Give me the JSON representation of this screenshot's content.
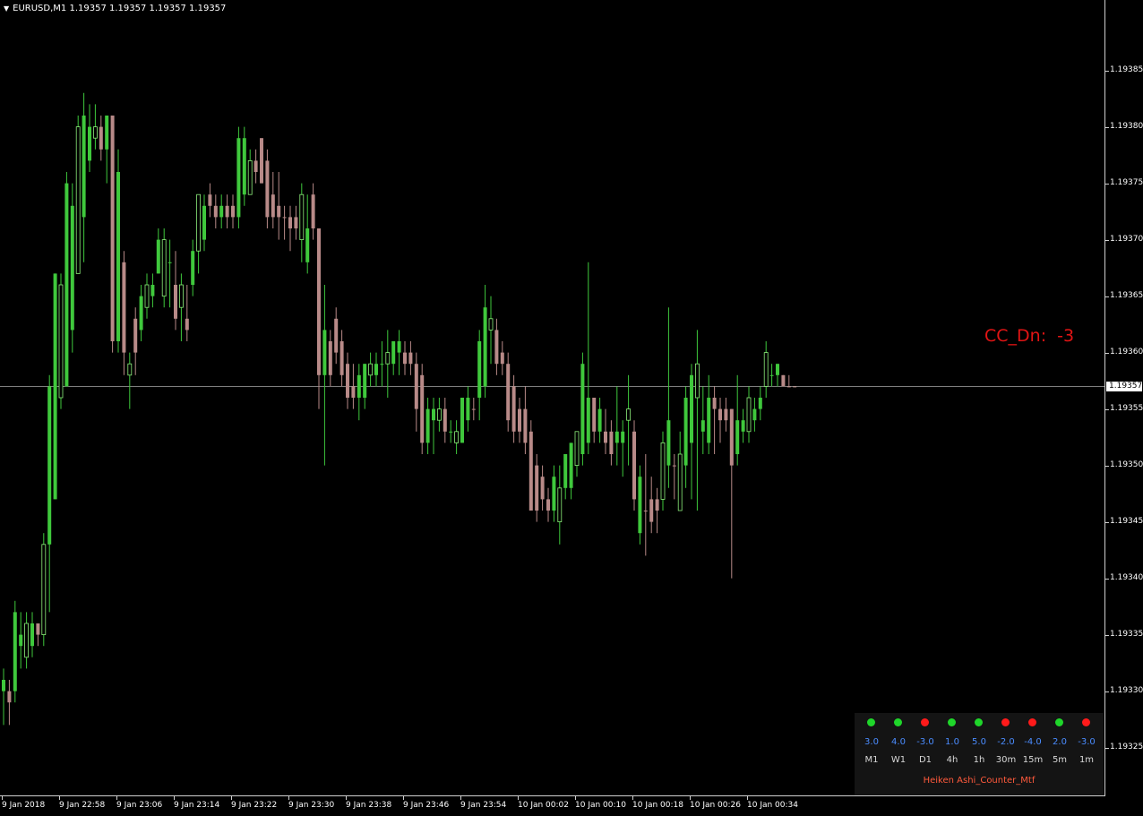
{
  "title": {
    "symbol_line": "EURUSD,M1  1.19357 1.19357 1.19357 1.19357"
  },
  "colors": {
    "background": "#000000",
    "bull": "#3fc83c",
    "bull_outline": "#8ef07c",
    "bear": "#b88a88",
    "wick": "#3fc83c",
    "cc_label": "#e11414",
    "mtf_value": "#4a8cff",
    "dot_up": "#1fd62a",
    "dot_down": "#ff1a1a",
    "indicator_name": "#ff5a3c"
  },
  "price_axis": {
    "labels": [
      "1.19385",
      "1.19380",
      "1.19375",
      "1.19370",
      "1.19365",
      "1.19360",
      "1.19355",
      "1.19350",
      "1.19345",
      "1.19340",
      "1.19335",
      "1.19330",
      "1.19325"
    ],
    "current_price": "1.19357"
  },
  "time_axis": {
    "labels": [
      "9 Jan 2018",
      "9 Jan 22:58",
      "9 Jan 23:06",
      "9 Jan 23:14",
      "9 Jan 23:22",
      "9 Jan 23:30",
      "9 Jan 23:38",
      "9 Jan 23:46",
      "9 Jan 23:54",
      "10 Jan 00:02",
      "10 Jan 00:10",
      "10 Jan 00:18",
      "10 Jan 00:26",
      "10 Jan 00:34"
    ]
  },
  "cc_label": {
    "text": "CC_Dn:  -3"
  },
  "mtf_panel": {
    "indicator_name": "Heiken Ashi_Counter_Mtf",
    "timeframes": [
      {
        "tf": "M1",
        "value": "3.0",
        "dir": "up"
      },
      {
        "tf": "W1",
        "value": "4.0",
        "dir": "up"
      },
      {
        "tf": "D1",
        "value": "-3.0",
        "dir": "down"
      },
      {
        "tf": "4h",
        "value": "1.0",
        "dir": "up"
      },
      {
        "tf": "1h",
        "value": "5.0",
        "dir": "up"
      },
      {
        "tf": "30m",
        "value": "-2.0",
        "dir": "down"
      },
      {
        "tf": "15m",
        "value": "-4.0",
        "dir": "down"
      },
      {
        "tf": "5m",
        "value": "2.0",
        "dir": "up"
      },
      {
        "tf": "1m",
        "value": "-3.0",
        "dir": "down"
      }
    ]
  },
  "chart_data": {
    "type": "candlestick",
    "symbol": "EURUSD",
    "timeframe": "M1",
    "ylim": [
      1.19321,
      1.19391
    ],
    "current_price": 1.19357,
    "candles": [
      {
        "o": 1.1933,
        "h": 1.19332,
        "l": 1.19327,
        "c": 1.19331,
        "s": "bull"
      },
      {
        "o": 1.19329,
        "h": 1.19331,
        "l": 1.19327,
        "c": 1.1933,
        "s": "bear"
      },
      {
        "o": 1.1933,
        "h": 1.19338,
        "l": 1.19329,
        "c": 1.19337,
        "s": "bull"
      },
      {
        "o": 1.19334,
        "h": 1.19337,
        "l": 1.19332,
        "c": 1.19335,
        "s": "bull"
      },
      {
        "o": 1.19333,
        "h": 1.19337,
        "l": 1.19332,
        "c": 1.19336,
        "s": "bull"
      },
      {
        "o": 1.19334,
        "h": 1.19337,
        "l": 1.19333,
        "c": 1.19336,
        "s": "bull"
      },
      {
        "o": 1.19336,
        "h": 1.19336,
        "l": 1.19334,
        "c": 1.19335,
        "s": "bear"
      },
      {
        "o": 1.19335,
        "h": 1.19344,
        "l": 1.19334,
        "c": 1.19343,
        "s": "bull"
      },
      {
        "o": 1.19343,
        "h": 1.19358,
        "l": 1.19337,
        "c": 1.19357,
        "s": "bull"
      },
      {
        "o": 1.19347,
        "h": 1.19367,
        "l": 1.19347,
        "c": 1.19367,
        "s": "bull"
      },
      {
        "o": 1.19356,
        "h": 1.19367,
        "l": 1.19355,
        "c": 1.19366,
        "s": "bull"
      },
      {
        "o": 1.19357,
        "h": 1.19376,
        "l": 1.19357,
        "c": 1.19375,
        "s": "bull"
      },
      {
        "o": 1.19362,
        "h": 1.19375,
        "l": 1.1936,
        "c": 1.19373,
        "s": "bull"
      },
      {
        "o": 1.19367,
        "h": 1.19381,
        "l": 1.19367,
        "c": 1.1938,
        "s": "bull"
      },
      {
        "o": 1.19372,
        "h": 1.19383,
        "l": 1.19368,
        "c": 1.19381,
        "s": "bull"
      },
      {
        "o": 1.19377,
        "h": 1.19382,
        "l": 1.19376,
        "c": 1.1938,
        "s": "bull"
      },
      {
        "o": 1.19379,
        "h": 1.19382,
        "l": 1.19378,
        "c": 1.1938,
        "s": "bull"
      },
      {
        "o": 1.1938,
        "h": 1.19381,
        "l": 1.19377,
        "c": 1.19378,
        "s": "bear"
      },
      {
        "o": 1.19378,
        "h": 1.19381,
        "l": 1.19375,
        "c": 1.19381,
        "s": "bull"
      },
      {
        "o": 1.19381,
        "h": 1.19381,
        "l": 1.1936,
        "c": 1.19361,
        "s": "bear"
      },
      {
        "o": 1.19376,
        "h": 1.19378,
        "l": 1.1936,
        "c": 1.19361,
        "s": "bull"
      },
      {
        "o": 1.19368,
        "h": 1.19369,
        "l": 1.19358,
        "c": 1.1936,
        "s": "bear"
      },
      {
        "o": 1.19358,
        "h": 1.1936,
        "l": 1.19355,
        "c": 1.19359,
        "s": "bull"
      },
      {
        "o": 1.19363,
        "h": 1.19364,
        "l": 1.19358,
        "c": 1.1936,
        "s": "bear"
      },
      {
        "o": 1.19362,
        "h": 1.19366,
        "l": 1.19361,
        "c": 1.19365,
        "s": "bull"
      },
      {
        "o": 1.19364,
        "h": 1.19367,
        "l": 1.19363,
        "c": 1.19366,
        "s": "bull"
      },
      {
        "o": 1.19365,
        "h": 1.19367,
        "l": 1.19364,
        "c": 1.19366,
        "s": "bull"
      },
      {
        "o": 1.19367,
        "h": 1.19371,
        "l": 1.19367,
        "c": 1.1937,
        "s": "bull"
      },
      {
        "o": 1.19365,
        "h": 1.19371,
        "l": 1.19364,
        "c": 1.1937,
        "s": "bull"
      },
      {
        "o": 1.19368,
        "h": 1.1937,
        "l": 1.19364,
        "c": 1.19368,
        "s": "bull"
      },
      {
        "o": 1.19366,
        "h": 1.19369,
        "l": 1.19362,
        "c": 1.19363,
        "s": "bear"
      },
      {
        "o": 1.19364,
        "h": 1.19367,
        "l": 1.19361,
        "c": 1.19366,
        "s": "bull"
      },
      {
        "o": 1.19363,
        "h": 1.19366,
        "l": 1.19361,
        "c": 1.19362,
        "s": "bear"
      },
      {
        "o": 1.19366,
        "h": 1.1937,
        "l": 1.19365,
        "c": 1.19369,
        "s": "bull"
      },
      {
        "o": 1.19369,
        "h": 1.19374,
        "l": 1.19367,
        "c": 1.19374,
        "s": "bull"
      },
      {
        "o": 1.1937,
        "h": 1.19374,
        "l": 1.19369,
        "c": 1.19373,
        "s": "bull"
      },
      {
        "o": 1.19374,
        "h": 1.19375,
        "l": 1.19372,
        "c": 1.19373,
        "s": "bear"
      },
      {
        "o": 1.19373,
        "h": 1.19374,
        "l": 1.19371,
        "c": 1.19372,
        "s": "bear"
      },
      {
        "o": 1.19372,
        "h": 1.19374,
        "l": 1.19371,
        "c": 1.19373,
        "s": "bull"
      },
      {
        "o": 1.19373,
        "h": 1.19374,
        "l": 1.19371,
        "c": 1.19372,
        "s": "bear"
      },
      {
        "o": 1.19373,
        "h": 1.19374,
        "l": 1.19371,
        "c": 1.19372,
        "s": "bear"
      },
      {
        "o": 1.19372,
        "h": 1.1938,
        "l": 1.19371,
        "c": 1.19379,
        "s": "bull"
      },
      {
        "o": 1.19374,
        "h": 1.1938,
        "l": 1.19373,
        "c": 1.19379,
        "s": "bull"
      },
      {
        "o": 1.19374,
        "h": 1.19378,
        "l": 1.19374,
        "c": 1.19377,
        "s": "bull"
      },
      {
        "o": 1.19377,
        "h": 1.19378,
        "l": 1.19375,
        "c": 1.19376,
        "s": "bear"
      },
      {
        "o": 1.19379,
        "h": 1.19379,
        "l": 1.19375,
        "c": 1.19375,
        "s": "bear"
      },
      {
        "o": 1.19377,
        "h": 1.19378,
        "l": 1.19371,
        "c": 1.19372,
        "s": "bear"
      },
      {
        "o": 1.19374,
        "h": 1.19376,
        "l": 1.19371,
        "c": 1.19372,
        "s": "bear"
      },
      {
        "o": 1.19373,
        "h": 1.19376,
        "l": 1.1937,
        "c": 1.19372,
        "s": "bear"
      },
      {
        "o": 1.19372,
        "h": 1.19373,
        "l": 1.1937,
        "c": 1.19372,
        "s": "bear"
      },
      {
        "o": 1.19372,
        "h": 1.19373,
        "l": 1.19369,
        "c": 1.19371,
        "s": "bear"
      },
      {
        "o": 1.19371,
        "h": 1.19373,
        "l": 1.1937,
        "c": 1.19372,
        "s": "bear"
      },
      {
        "o": 1.1937,
        "h": 1.19375,
        "l": 1.19368,
        "c": 1.19374,
        "s": "bull"
      },
      {
        "o": 1.19368,
        "h": 1.19374,
        "l": 1.19367,
        "c": 1.19371,
        "s": "bull"
      },
      {
        "o": 1.19374,
        "h": 1.19375,
        "l": 1.1937,
        "c": 1.19371,
        "s": "bear"
      },
      {
        "o": 1.19371,
        "h": 1.19371,
        "l": 1.19355,
        "c": 1.19358,
        "s": "bear"
      },
      {
        "o": 1.19362,
        "h": 1.19366,
        "l": 1.1935,
        "c": 1.19358,
        "s": "bull"
      },
      {
        "o": 1.19361,
        "h": 1.19362,
        "l": 1.19357,
        "c": 1.19358,
        "s": "bear"
      },
      {
        "o": 1.19363,
        "h": 1.19364,
        "l": 1.19359,
        "c": 1.1936,
        "s": "bear"
      },
      {
        "o": 1.19361,
        "h": 1.19362,
        "l": 1.19357,
        "c": 1.19358,
        "s": "bear"
      },
      {
        "o": 1.19359,
        "h": 1.1936,
        "l": 1.19355,
        "c": 1.19356,
        "s": "bear"
      },
      {
        "o": 1.19357,
        "h": 1.19359,
        "l": 1.19355,
        "c": 1.19356,
        "s": "bear"
      },
      {
        "o": 1.19356,
        "h": 1.19359,
        "l": 1.19354,
        "c": 1.19358,
        "s": "bull"
      },
      {
        "o": 1.19356,
        "h": 1.19359,
        "l": 1.19355,
        "c": 1.19359,
        "s": "bull"
      },
      {
        "o": 1.19358,
        "h": 1.1936,
        "l": 1.19357,
        "c": 1.19359,
        "s": "bull"
      },
      {
        "o": 1.19359,
        "h": 1.1936,
        "l": 1.19357,
        "c": 1.19358,
        "s": "bull"
      },
      {
        "o": 1.19359,
        "h": 1.19361,
        "l": 1.19357,
        "c": 1.19359,
        "s": "bull"
      },
      {
        "o": 1.19359,
        "h": 1.19362,
        "l": 1.19356,
        "c": 1.1936,
        "s": "bull"
      },
      {
        "o": 1.19359,
        "h": 1.19361,
        "l": 1.19358,
        "c": 1.19361,
        "s": "bull"
      },
      {
        "o": 1.1936,
        "h": 1.19362,
        "l": 1.19358,
        "c": 1.19361,
        "s": "bull"
      },
      {
        "o": 1.1936,
        "h": 1.19361,
        "l": 1.19358,
        "c": 1.19359,
        "s": "bear"
      },
      {
        "o": 1.1936,
        "h": 1.19361,
        "l": 1.19358,
        "c": 1.19359,
        "s": "bear"
      },
      {
        "o": 1.19359,
        "h": 1.1936,
        "l": 1.19353,
        "c": 1.19355,
        "s": "bear"
      },
      {
        "o": 1.19358,
        "h": 1.19359,
        "l": 1.19351,
        "c": 1.19352,
        "s": "bear"
      },
      {
        "o": 1.19352,
        "h": 1.19356,
        "l": 1.19351,
        "c": 1.19355,
        "s": "bull"
      },
      {
        "o": 1.19355,
        "h": 1.19356,
        "l": 1.19351,
        "c": 1.19354,
        "s": "bull"
      },
      {
        "o": 1.19355,
        "h": 1.19356,
        "l": 1.19353,
        "c": 1.19354,
        "s": "bull"
      },
      {
        "o": 1.19355,
        "h": 1.19356,
        "l": 1.19352,
        "c": 1.19353,
        "s": "bear"
      },
      {
        "o": 1.19353,
        "h": 1.19354,
        "l": 1.19352,
        "c": 1.19353,
        "s": "bull"
      },
      {
        "o": 1.19352,
        "h": 1.19354,
        "l": 1.19351,
        "c": 1.19353,
        "s": "bull"
      },
      {
        "o": 1.19352,
        "h": 1.19356,
        "l": 1.19352,
        "c": 1.19356,
        "s": "bull"
      },
      {
        "o": 1.19354,
        "h": 1.19357,
        "l": 1.19353,
        "c": 1.19356,
        "s": "bull"
      },
      {
        "o": 1.19355,
        "h": 1.19356,
        "l": 1.19354,
        "c": 1.19355,
        "s": "bear"
      },
      {
        "o": 1.19356,
        "h": 1.19362,
        "l": 1.19354,
        "c": 1.19361,
        "s": "bull"
      },
      {
        "o": 1.19357,
        "h": 1.19366,
        "l": 1.19356,
        "c": 1.19364,
        "s": "bull"
      },
      {
        "o": 1.19362,
        "h": 1.19365,
        "l": 1.19359,
        "c": 1.19363,
        "s": "bull"
      },
      {
        "o": 1.19362,
        "h": 1.19363,
        "l": 1.19358,
        "c": 1.19359,
        "s": "bear"
      },
      {
        "o": 1.1936,
        "h": 1.19361,
        "l": 1.19358,
        "c": 1.19359,
        "s": "bear"
      },
      {
        "o": 1.19359,
        "h": 1.1936,
        "l": 1.19353,
        "c": 1.19354,
        "s": "bear"
      },
      {
        "o": 1.19357,
        "h": 1.19358,
        "l": 1.19352,
        "c": 1.19353,
        "s": "bear"
      },
      {
        "o": 1.19355,
        "h": 1.19356,
        "l": 1.19352,
        "c": 1.19353,
        "s": "bear"
      },
      {
        "o": 1.19355,
        "h": 1.19357,
        "l": 1.19351,
        "c": 1.19352,
        "s": "bear"
      },
      {
        "o": 1.19353,
        "h": 1.19354,
        "l": 1.19346,
        "c": 1.19346,
        "s": "bear"
      },
      {
        "o": 1.1935,
        "h": 1.19351,
        "l": 1.19345,
        "c": 1.19346,
        "s": "bear"
      },
      {
        "o": 1.19349,
        "h": 1.1935,
        "l": 1.19346,
        "c": 1.19347,
        "s": "bear"
      },
      {
        "o": 1.19347,
        "h": 1.19348,
        "l": 1.19345,
        "c": 1.19346,
        "s": "bear"
      },
      {
        "o": 1.19346,
        "h": 1.1935,
        "l": 1.19345,
        "c": 1.19349,
        "s": "bull"
      },
      {
        "o": 1.19345,
        "h": 1.1935,
        "l": 1.19343,
        "c": 1.19348,
        "s": "bull"
      },
      {
        "o": 1.19348,
        "h": 1.19351,
        "l": 1.19347,
        "c": 1.19351,
        "s": "bull"
      },
      {
        "o": 1.19348,
        "h": 1.19352,
        "l": 1.19347,
        "c": 1.19352,
        "s": "bull"
      },
      {
        "o": 1.1935,
        "h": 1.19353,
        "l": 1.19349,
        "c": 1.19353,
        "s": "bull"
      },
      {
        "o": 1.19351,
        "h": 1.1936,
        "l": 1.1935,
        "c": 1.19359,
        "s": "bull"
      },
      {
        "o": 1.19356,
        "h": 1.19368,
        "l": 1.19351,
        "c": 1.19352,
        "s": "bull"
      },
      {
        "o": 1.19356,
        "h": 1.19356,
        "l": 1.19352,
        "c": 1.19353,
        "s": "bear"
      },
      {
        "o": 1.19355,
        "h": 1.19356,
        "l": 1.19352,
        "c": 1.19353,
        "s": "bull"
      },
      {
        "o": 1.19353,
        "h": 1.19355,
        "l": 1.19351,
        "c": 1.19352,
        "s": "bear"
      },
      {
        "o": 1.19353,
        "h": 1.19354,
        "l": 1.1935,
        "c": 1.19351,
        "s": "bear"
      },
      {
        "o": 1.19352,
        "h": 1.19357,
        "l": 1.1935,
        "c": 1.19353,
        "s": "bull"
      },
      {
        "o": 1.19352,
        "h": 1.19354,
        "l": 1.19349,
        "c": 1.19353,
        "s": "bull"
      },
      {
        "o": 1.19354,
        "h": 1.19358,
        "l": 1.1935,
        "c": 1.19355,
        "s": "bull"
      },
      {
        "o": 1.19353,
        "h": 1.19354,
        "l": 1.19346,
        "c": 1.19347,
        "s": "bear"
      },
      {
        "o": 1.19349,
        "h": 1.1935,
        "l": 1.19343,
        "c": 1.19344,
        "s": "bull"
      },
      {
        "o": 1.19346,
        "h": 1.19351,
        "l": 1.19342,
        "c": 1.19346,
        "s": "bear"
      },
      {
        "o": 1.19347,
        "h": 1.19349,
        "l": 1.19344,
        "c": 1.19345,
        "s": "bear"
      },
      {
        "o": 1.19346,
        "h": 1.19348,
        "l": 1.19344,
        "c": 1.19347,
        "s": "bear"
      },
      {
        "o": 1.19347,
        "h": 1.19353,
        "l": 1.19346,
        "c": 1.19352,
        "s": "bull"
      },
      {
        "o": 1.1935,
        "h": 1.19364,
        "l": 1.19348,
        "c": 1.19354,
        "s": "bull"
      },
      {
        "o": 1.1935,
        "h": 1.19351,
        "l": 1.19347,
        "c": 1.1935,
        "s": "bear"
      },
      {
        "o": 1.19346,
        "h": 1.19353,
        "l": 1.19346,
        "c": 1.19351,
        "s": "bull"
      },
      {
        "o": 1.1935,
        "h": 1.19357,
        "l": 1.19348,
        "c": 1.19356,
        "s": "bull"
      },
      {
        "o": 1.19352,
        "h": 1.19359,
        "l": 1.19347,
        "c": 1.19358,
        "s": "bull"
      },
      {
        "o": 1.19356,
        "h": 1.19362,
        "l": 1.19346,
        "c": 1.19359,
        "s": "bull"
      },
      {
        "o": 1.19353,
        "h": 1.19357,
        "l": 1.19351,
        "c": 1.19354,
        "s": "bull"
      },
      {
        "o": 1.19352,
        "h": 1.19358,
        "l": 1.19351,
        "c": 1.19356,
        "s": "bull"
      },
      {
        "o": 1.19356,
        "h": 1.19357,
        "l": 1.19351,
        "c": 1.19355,
        "s": "bear"
      },
      {
        "o": 1.19355,
        "h": 1.19356,
        "l": 1.19352,
        "c": 1.19354,
        "s": "bear"
      },
      {
        "o": 1.19354,
        "h": 1.19356,
        "l": 1.19353,
        "c": 1.19355,
        "s": "bear"
      },
      {
        "o": 1.19355,
        "h": 1.19355,
        "l": 1.1934,
        "c": 1.1935,
        "s": "bear"
      },
      {
        "o": 1.19351,
        "h": 1.19358,
        "l": 1.1935,
        "c": 1.19354,
        "s": "bull"
      },
      {
        "o": 1.19353,
        "h": 1.19355,
        "l": 1.19352,
        "c": 1.19354,
        "s": "bull"
      },
      {
        "o": 1.19353,
        "h": 1.19357,
        "l": 1.19352,
        "c": 1.19356,
        "s": "bull"
      },
      {
        "o": 1.19354,
        "h": 1.19356,
        "l": 1.19353,
        "c": 1.19355,
        "s": "bull"
      },
      {
        "o": 1.19355,
        "h": 1.19357,
        "l": 1.19354,
        "c": 1.19356,
        "s": "bull"
      },
      {
        "o": 1.19357,
        "h": 1.19361,
        "l": 1.19356,
        "c": 1.1936,
        "s": "bull"
      },
      {
        "o": 1.19358,
        "h": 1.19359,
        "l": 1.19357,
        "c": 1.19358,
        "s": "bull"
      },
      {
        "o": 1.19358,
        "h": 1.19359,
        "l": 1.19357,
        "c": 1.19359,
        "s": "bull"
      },
      {
        "o": 1.19358,
        "h": 1.19358,
        "l": 1.19357,
        "c": 1.19357,
        "s": "bear"
      },
      {
        "o": 1.19357,
        "h": 1.19358,
        "l": 1.19357,
        "c": 1.19357,
        "s": "bear"
      },
      {
        "o": 1.19357,
        "h": 1.19357,
        "l": 1.19357,
        "c": 1.19357,
        "s": "bear"
      }
    ]
  }
}
